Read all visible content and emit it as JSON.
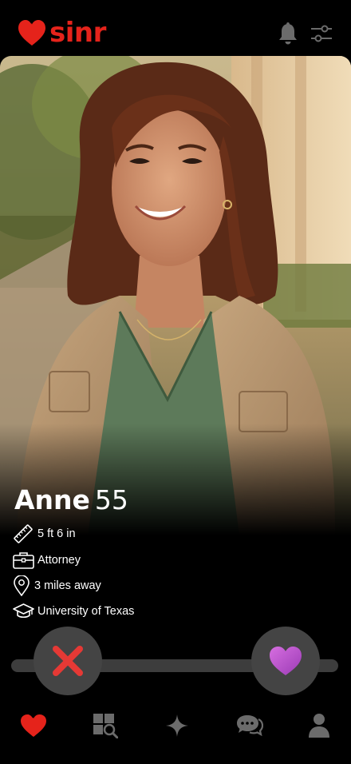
{
  "app": {
    "name": "sinr",
    "brand_color": "#e5231b"
  },
  "header": {
    "icons": [
      "bell-icon",
      "filter-sliders-icon"
    ]
  },
  "profile": {
    "name": "Anne",
    "age": "55",
    "details": [
      {
        "icon": "ruler-icon",
        "text": "5 ft 6 in"
      },
      {
        "icon": "briefcase-icon",
        "text": "Attorney"
      },
      {
        "icon": "location-pin-icon",
        "text": "3 miles away"
      },
      {
        "icon": "graduation-cap-icon",
        "text": "University of Texas"
      }
    ]
  },
  "actions": {
    "nope_icon": "x-icon",
    "like_icon": "heart-icon",
    "nope_color": "#e53935",
    "like_color": "#b44ec9"
  },
  "bottom_nav": {
    "items": [
      {
        "icon": "heart-icon",
        "active": true
      },
      {
        "icon": "explore-grid-icon",
        "active": false
      },
      {
        "icon": "sparkle-icon",
        "active": false
      },
      {
        "icon": "chat-bubbles-icon",
        "active": false
      },
      {
        "icon": "profile-icon",
        "active": false
      }
    ]
  }
}
